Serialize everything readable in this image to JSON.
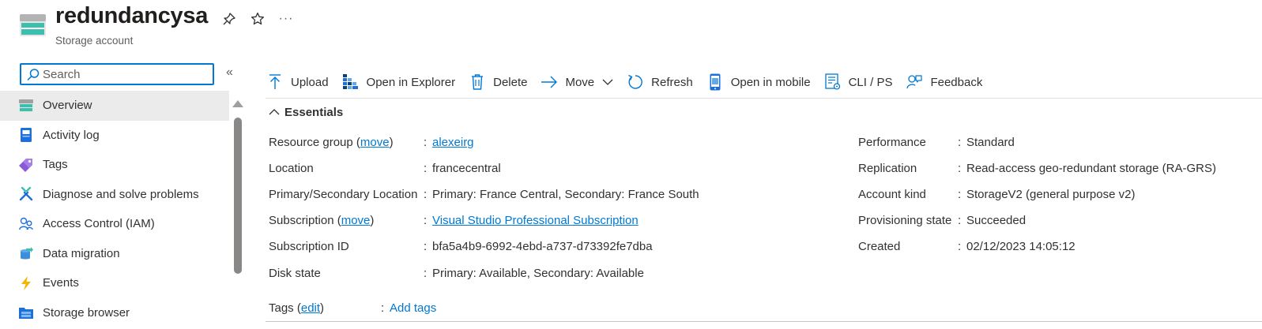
{
  "header": {
    "title": "redundancysa",
    "subtitle": "Storage account",
    "more_label": "···"
  },
  "sidebar": {
    "search_placeholder": "Search",
    "collapse_label": "«",
    "items": [
      {
        "label": "Overview",
        "icon": "overview-icon"
      },
      {
        "label": "Activity log",
        "icon": "activity-log-icon"
      },
      {
        "label": "Tags",
        "icon": "tag-icon"
      },
      {
        "label": "Diagnose and solve problems",
        "icon": "wrench-icon"
      },
      {
        "label": "Access Control (IAM)",
        "icon": "people-icon"
      },
      {
        "label": "Data migration",
        "icon": "data-migration-icon"
      },
      {
        "label": "Events",
        "icon": "lightning-icon"
      },
      {
        "label": "Storage browser",
        "icon": "storage-browser-icon"
      }
    ]
  },
  "toolbar": {
    "upload": "Upload",
    "open_in_explorer": "Open in Explorer",
    "delete": "Delete",
    "move": "Move",
    "refresh": "Refresh",
    "open_in_mobile": "Open in mobile",
    "cli_ps": "CLI / PS",
    "feedback": "Feedback"
  },
  "essentials": {
    "title": "Essentials",
    "colon": ":",
    "left": {
      "resource_group_label_pre": "Resource group (",
      "resource_group_move": "move",
      "resource_group_label_post": ")",
      "resource_group_value": "alexeirg",
      "location_label": "Location",
      "location_value": "francecentral",
      "primary_secondary_label": "Primary/Secondary Location",
      "primary_secondary_value": "Primary: France Central, Secondary: France South",
      "subscription_label_pre": "Subscription (",
      "subscription_move": "move",
      "subscription_label_post": ")",
      "subscription_value": "Visual Studio Professional Subscription",
      "subscription_id_label": "Subscription ID",
      "subscription_id_value": "bfa5a4b9-6992-4ebd-a737-d73392fe7dba",
      "disk_state_label": "Disk state",
      "disk_state_value": "Primary: Available, Secondary: Available"
    },
    "right": {
      "performance_label": "Performance",
      "performance_value": "Standard",
      "replication_label": "Replication",
      "replication_value": "Read-access geo-redundant storage (RA-GRS)",
      "account_kind_label": "Account kind",
      "account_kind_value": "StorageV2 (general purpose v2)",
      "provisioning_label": "Provisioning state",
      "provisioning_value": "Succeeded",
      "created_label": "Created",
      "created_value": "02/12/2023 14:05:12"
    },
    "tags": {
      "label_pre": "Tags (",
      "edit": "edit",
      "label_post": ")",
      "add_tags": "Add tags"
    }
  },
  "colors": {
    "accent": "#0078d4",
    "storage_teal": "#3cbfae",
    "active_bg": "#ebebeb"
  }
}
